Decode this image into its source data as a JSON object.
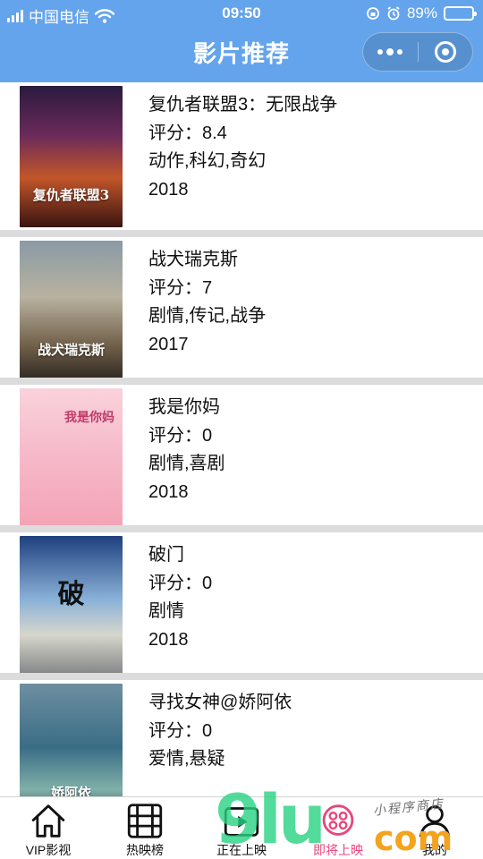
{
  "status_bar": {
    "carrier": "中国电信",
    "time": "09:50",
    "battery": "89%",
    "battery_level": 0.89
  },
  "nav": {
    "title": "影片推荐"
  },
  "movies": [
    {
      "title": "复仇者联盟3：无限战争",
      "rating": "评分：8.4",
      "genres": "动作,科幻,奇幻",
      "year": "2018",
      "poster_text": "复仇者联盟3"
    },
    {
      "title": "战犬瑞克斯",
      "rating": "评分：7",
      "genres": "剧情,传记,战争",
      "year": "2017",
      "poster_text": "战犬瑞克斯"
    },
    {
      "title": "我是你妈",
      "rating": "评分：0",
      "genres": "剧情,喜剧",
      "year": "2018",
      "poster_text": "我是你妈"
    },
    {
      "title": "破门",
      "rating": "评分：0",
      "genres": "剧情",
      "year": "2018",
      "poster_text": "破"
    },
    {
      "title": "寻找女神@娇阿依",
      "rating": "评分：0",
      "genres": "爱情,悬疑",
      "year": "",
      "poster_text": "娇阿依"
    }
  ],
  "tabs": [
    {
      "label": "VIP影视",
      "icon": "home-icon"
    },
    {
      "label": "热映榜",
      "icon": "film-reel-icon"
    },
    {
      "label": "正在上映",
      "icon": "movie-player-icon"
    },
    {
      "label": "即将上映",
      "icon": "coming-soon-icon"
    },
    {
      "label": "我的",
      "icon": "user-icon"
    }
  ],
  "watermark": {
    "big": "9lu",
    "com": "com",
    "small": "小程序商店"
  },
  "colors": {
    "nav_bg": "#64a4ec",
    "separator": "#dcdcdc",
    "watermark_green": "#28d282",
    "watermark_orange": "#f4a31d"
  }
}
